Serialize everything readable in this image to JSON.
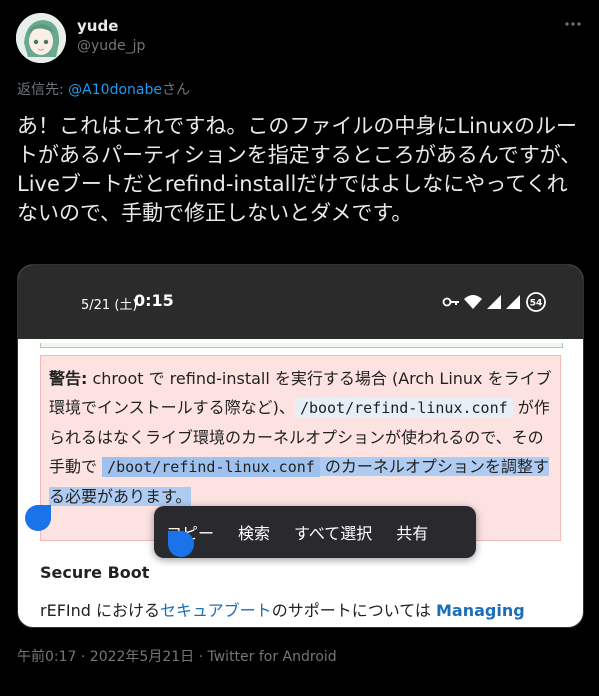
{
  "author": {
    "display_name": "yude",
    "handle": "@yude_jp"
  },
  "reply": {
    "prefix": "返信先: ",
    "mention": "@A10donabe",
    "suffix": "さん"
  },
  "tweet": {
    "text": "あ！これはこれですね。このファイルの中身にLinuxのルートがあるパーティションを指定するところがあるんですが、Liveブートだとrefind-installだけではよしなにやってくれないので、手動で修正しないとダメです。"
  },
  "screenshot": {
    "status_date": "5/21 (土)",
    "status_time": "0:15",
    "battery": "54",
    "warning_label": "警告:",
    "warning_part1": " chroot で refind-install を実行する場合 (Arch Linux をライブ環境でインストールする際など)、",
    "code_path_1": "/boot/refind-linux.conf",
    "warning_part2": " が作られる",
    "warning_part3": "はなくライブ環境のカーネルオプションが使われるので、その手動で ",
    "code_path_2": "/boot/refind-linux.conf",
    "warning_part4": " のカーネルオプションを調整する必要があります。",
    "context_menu": [
      "コピー",
      "検索",
      "すべて選択",
      "共有"
    ],
    "secure_boot_heading": "Secure Boot",
    "secure_text_1": "rEFInd における",
    "secure_link": "セキュアブート",
    "secure_text_2": "のサポートについては ",
    "secure_link_2": "Managing"
  },
  "footer": {
    "meta": "午前0:17 · 2022年5月21日 · Twitter for Android"
  },
  "colors": {
    "background": "#000000",
    "link": "#1d9bf0",
    "selection_handle": "#1a73e8",
    "warning_bg": "#fde2e2"
  }
}
